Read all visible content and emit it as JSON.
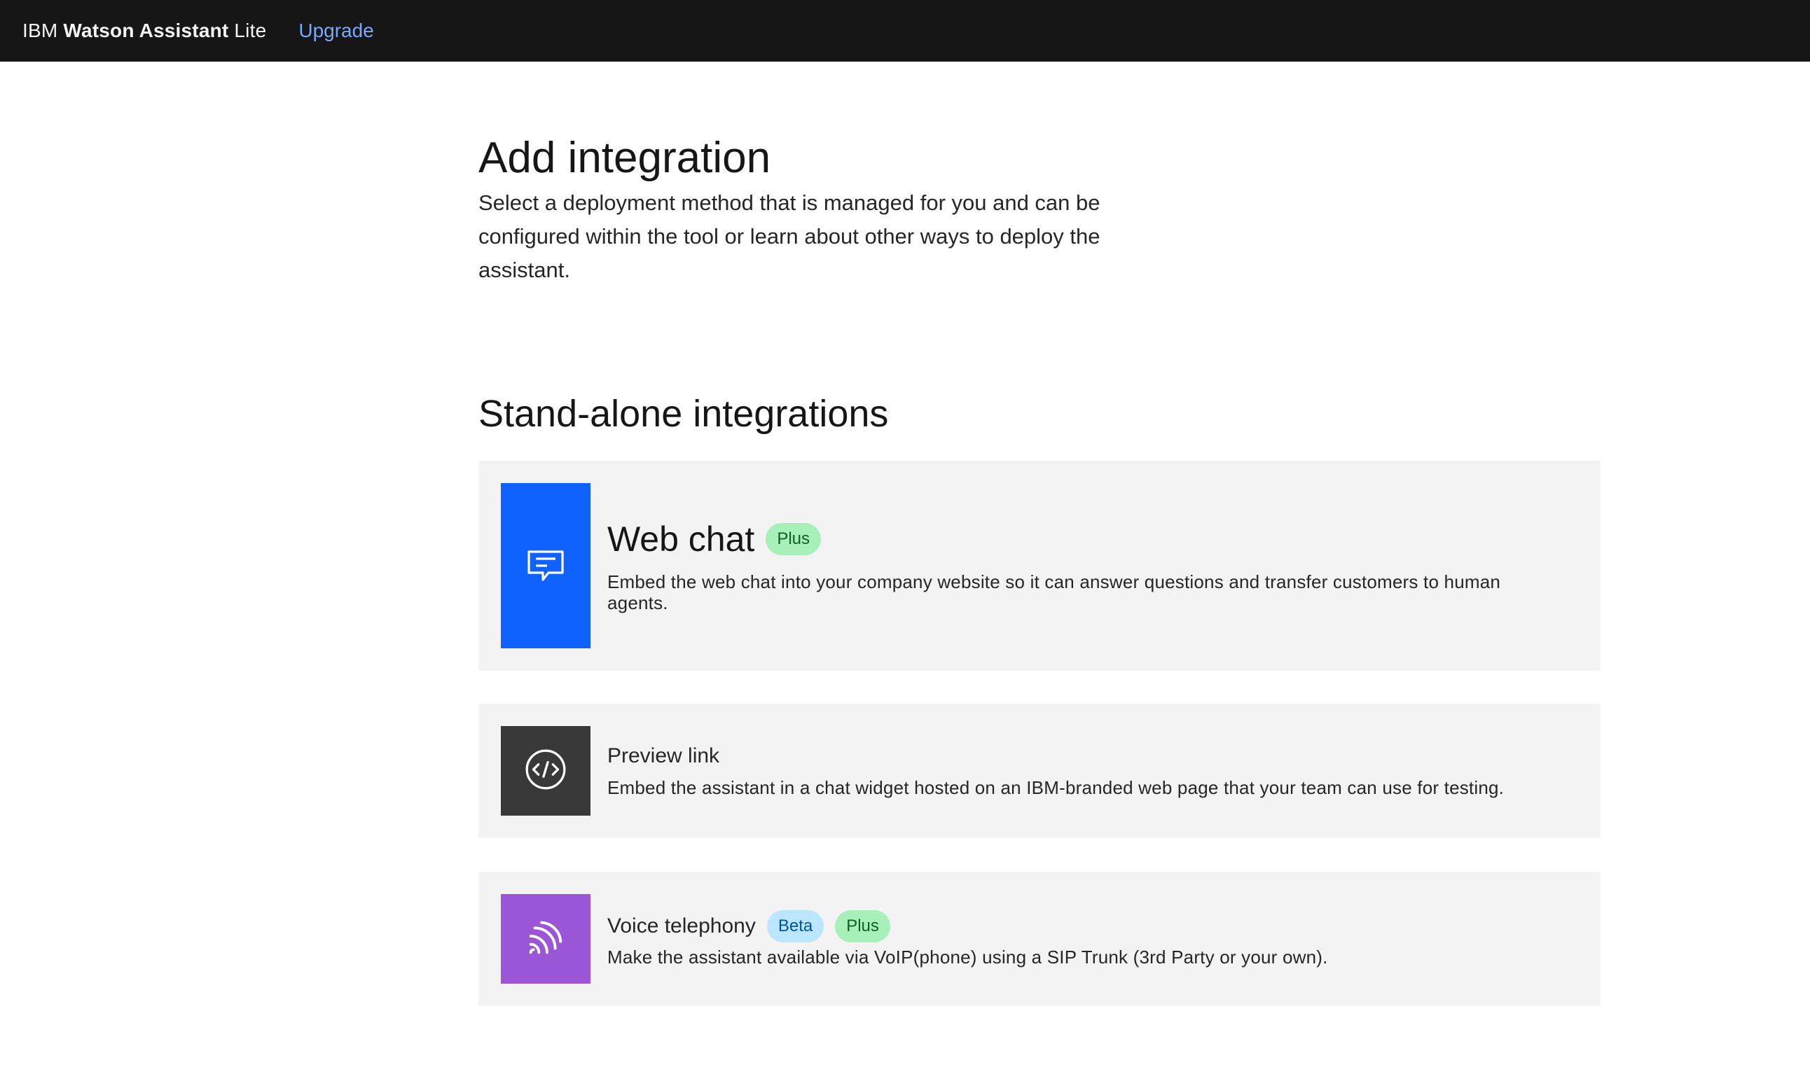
{
  "header": {
    "brand_prefix": "IBM",
    "brand_product": "Watson Assistant",
    "brand_plan": "Lite",
    "upgrade_label": "Upgrade"
  },
  "page": {
    "title": "Add integration",
    "description": "Select a deployment method that is managed for you and can be configured within the tool or learn about other ways to deploy the assistant."
  },
  "section": {
    "title": "Stand-alone integrations"
  },
  "integrations": [
    {
      "title": "Web chat",
      "icon": "chat-bubble-icon",
      "tile_color": "#0f62fe",
      "tags": [
        "Plus"
      ],
      "description": "Embed the web chat into your company website so it can answer questions and transfer customers to human agents."
    },
    {
      "title": "Preview link",
      "icon": "code-icon",
      "tile_color": "#393939",
      "tags": [],
      "description": "Embed the assistant in a chat widget hosted on an IBM-branded web page that your team can use for testing."
    },
    {
      "title": "Voice telephony",
      "icon": "voice-waves-icon",
      "tile_color": "#9b56d8",
      "tags": [
        "Beta",
        "Plus"
      ],
      "description": "Make the assistant available via VoIP(phone) using a SIP Trunk (3rd Party or your own)."
    }
  ],
  "colors": {
    "header_bg": "#161616",
    "link": "#78a9ff",
    "card_bg": "#f3f3f3",
    "tag_green_bg": "#a7f0ba",
    "tag_blue_bg": "#bae6ff"
  }
}
